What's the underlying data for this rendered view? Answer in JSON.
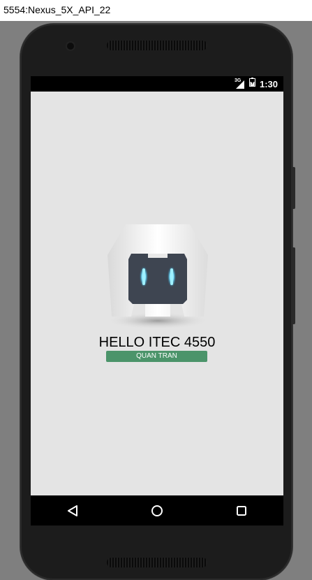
{
  "window": {
    "title": "5554:Nexus_5X_API_22"
  },
  "statusbar": {
    "network": "3G",
    "time": "1:30"
  },
  "app": {
    "heading": "HELLO ITEC 4550",
    "badge": "QUAN TRAN"
  },
  "colors": {
    "badge": "#4b946a",
    "screen_bg": "#e4e4e4"
  },
  "navbar": {
    "back_icon": "back-triangle-icon",
    "home_icon": "home-circle-icon",
    "recents_icon": "recents-square-icon"
  }
}
